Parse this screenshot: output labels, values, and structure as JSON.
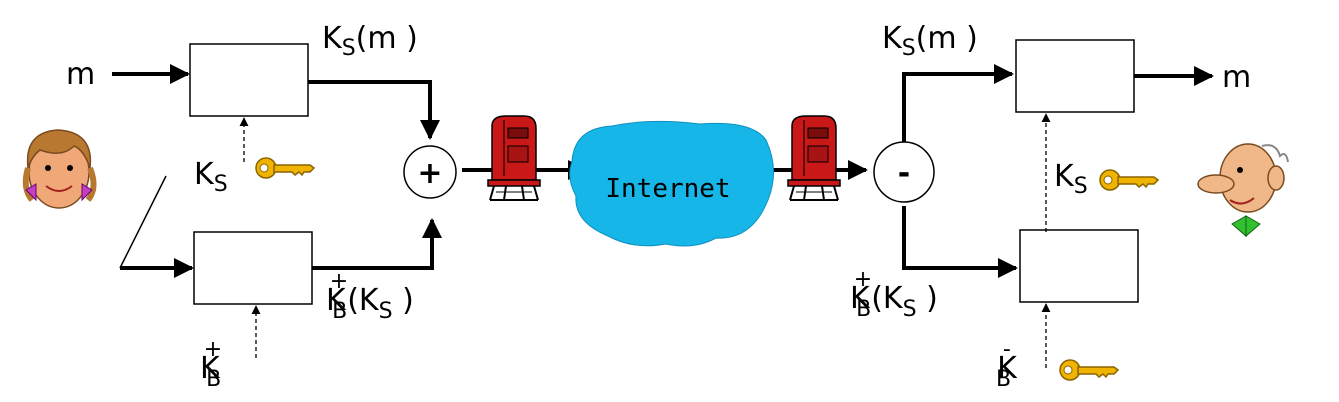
{
  "labels": {
    "m_in": "m",
    "m_out": "m",
    "ks_sym": "K",
    "ks_sub": "S",
    "ksm_left_K": "K",
    "ksm_left_S": "S",
    "ksm_left_rest": "(m )",
    "ksm_right_K": "K",
    "ksm_right_S": "S",
    "ksm_right_rest": "(m )",
    "kbks_left_K": "K",
    "kbks_left_plus": "+",
    "kbks_left_B": "B",
    "kbks_left_open": "(K",
    "kbks_left_S": "S",
    "kbks_left_close": " )",
    "kbks_right_K": "K",
    "kbks_right_plus": "+",
    "kbks_right_B": "B",
    "kbks_right_open": "(K",
    "kbks_right_S": "S",
    "kbks_right_close": " )",
    "kb_pub_K": "K",
    "kb_pub_plus": "+",
    "kb_pub_B": "B",
    "kb_priv_K": "K",
    "kb_priv_minus": "-",
    "kb_priv_B": "B",
    "ks_right_K": "K",
    "ks_right_S": "S",
    "plus_op": "+",
    "minus_op": "-",
    "internet": "Internet"
  },
  "colors": {
    "cloud": "#16b6e8",
    "key": "#f0b400",
    "mailbox": "#c81818"
  },
  "icons": [
    "alice-face-icon",
    "bob-face-icon",
    "key-icon",
    "mailbox-icon"
  ]
}
